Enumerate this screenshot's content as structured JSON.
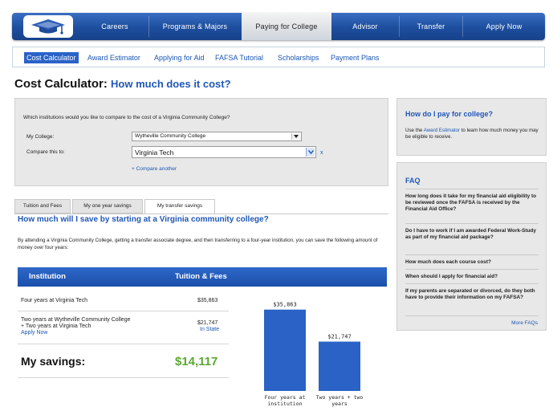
{
  "nav": {
    "tabs": [
      {
        "label": "Careers",
        "active": false
      },
      {
        "label": "Programs & Majors",
        "active": false
      },
      {
        "label": "Paying for College",
        "active": true
      },
      {
        "label": "Advisor",
        "active": false
      },
      {
        "label": "Transfer",
        "active": false
      },
      {
        "label": "Apply Now",
        "active": false
      }
    ]
  },
  "subnav": {
    "items": [
      {
        "label": "Cost Calculator",
        "active": true
      },
      {
        "label": "Award Estimator",
        "active": false
      },
      {
        "label": "Applying for Aid",
        "active": false
      },
      {
        "label": "FAFSA Tutorial",
        "active": false
      },
      {
        "label": "Scholarships",
        "active": false
      },
      {
        "label": "Payment Plans",
        "active": false
      }
    ]
  },
  "page": {
    "title": "Cost Calculator:",
    "subtitle": "How much does it cost?"
  },
  "compare": {
    "question": "Which institutions would you like to compare to the cost of a Virginia Community College?",
    "my_college_label": "My College:",
    "my_college_value": "Wytheville Community College",
    "compare_label": "Compare this to:",
    "compare_value": "Virginia Tech",
    "remove_label": "x",
    "add_label": "+ Compare another"
  },
  "tabs": {
    "tuition": "Tuition and Fees",
    "one_year": "My one year savings",
    "transfer": "My transfer savings"
  },
  "savings": {
    "heading": "How much will I save by starting at a Virginia community college?",
    "intro": "By attending a Virginia Community College, getting a transfer associate degree, and then transferring to a four-year institution, you can save the following amount of money over four years:",
    "col_institution": "Institution",
    "col_tuition": "Tuition & Fees",
    "row1_label": "Four years at Virginia Tech",
    "row1_value": "$35,863",
    "row2_line1": "Two years at Wytheville Community College",
    "row2_line2": "+ Two years at Virginia Tech",
    "row2_link": "Apply Now",
    "row2_value": "$21,747",
    "row2_note": "In State",
    "savings_label": "My savings:",
    "savings_value": "$14,117"
  },
  "chart_data": {
    "type": "bar",
    "categories": [
      "Four years at institution",
      "Two years + two years"
    ],
    "values": [
      35863,
      21747
    ],
    "value_labels": [
      "$35,863",
      "$21,747"
    ],
    "category_lines": [
      [
        "Four years at",
        "institution"
      ],
      [
        "Two years + two",
        "years"
      ]
    ],
    "ylim": [
      0,
      40000
    ],
    "color": "#2a62c6"
  },
  "aid": {
    "title": "How do I pay for college?",
    "text_before": "Use the ",
    "link": "Award Estimator",
    "text_after": " to learn how much money you may be eligible to receive."
  },
  "faq": {
    "title": "FAQ",
    "items": [
      "How long does it take for my financial aid eligibility to be reviewed once the FAFSA is received by the Financial Aid Office?",
      "Do I have to work if I am awarded Federal Work-Study as part of my financial aid package?",
      "How much does each course cost?",
      "When should I apply for financial aid?",
      "If my parents are separated or divorced, do they both have to provide their information on my FAFSA?"
    ],
    "more": "More FAQs"
  }
}
